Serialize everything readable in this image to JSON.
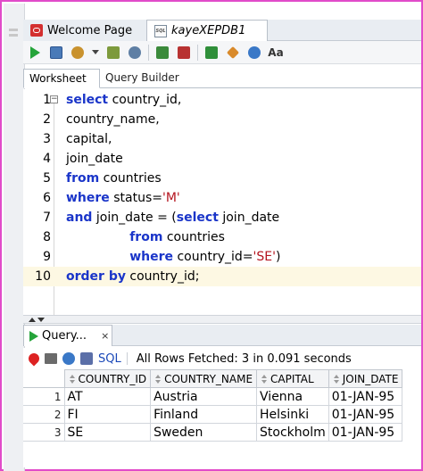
{
  "colors": {
    "frame_border": "#e14bc9",
    "keyword": "#1a35c9",
    "string_literal": "#b4141e",
    "run_icon": "#25a43a",
    "current_line_bg": "#fdf8e3"
  },
  "tabs": [
    {
      "label": "Welcome Page",
      "icon": "oracle-icon"
    },
    {
      "label": "kayeXEPDB1",
      "icon": "sql-worksheet-icon",
      "active": true
    }
  ],
  "toolbar": {
    "buttons": [
      "run-statement-icon",
      "run-script-icon",
      "commit-icon",
      "dropdown-arrow-icon",
      "explain-plan-icon",
      "autotrace-icon",
      "commit-transaction-icon",
      "rollback-icon",
      "sql-tuning-icon",
      "clear-icon",
      "sql-history-icon",
      "to-upper-lower-icon"
    ]
  },
  "worksheet_tabs": [
    {
      "label": "Worksheet",
      "active": true
    },
    {
      "label": "Query Builder",
      "active": false
    }
  ],
  "editor": {
    "current_line": 10,
    "lines": [
      {
        "n": "1",
        "tokens": [
          {
            "t": "select",
            "k": "kw"
          },
          {
            "t": " country_id,",
            "k": ""
          }
        ]
      },
      {
        "n": "2",
        "tokens": [
          {
            "t": "country_name,",
            "k": ""
          }
        ]
      },
      {
        "n": "3",
        "tokens": [
          {
            "t": "capital,",
            "k": ""
          }
        ]
      },
      {
        "n": "4",
        "tokens": [
          {
            "t": "join_date",
            "k": ""
          }
        ]
      },
      {
        "n": "5",
        "tokens": [
          {
            "t": "from",
            "k": "kw"
          },
          {
            "t": " countries",
            "k": ""
          }
        ]
      },
      {
        "n": "6",
        "tokens": [
          {
            "t": "where",
            "k": "kw"
          },
          {
            "t": " status=",
            "k": ""
          },
          {
            "t": "'M'",
            "k": "str"
          }
        ]
      },
      {
        "n": "7",
        "tokens": [
          {
            "t": "and",
            "k": "kw"
          },
          {
            "t": " join_date = (",
            "k": ""
          },
          {
            "t": "select",
            "k": "kw"
          },
          {
            "t": " join_date",
            "k": ""
          }
        ]
      },
      {
        "n": "8",
        "tokens": [
          {
            "t": "                ",
            "k": ""
          },
          {
            "t": "from",
            "k": "kw"
          },
          {
            "t": " countries",
            "k": ""
          }
        ]
      },
      {
        "n": "9",
        "tokens": [
          {
            "t": "                ",
            "k": ""
          },
          {
            "t": "where",
            "k": "kw"
          },
          {
            "t": " country_id=",
            "k": ""
          },
          {
            "t": "'SE'",
            "k": "str"
          },
          {
            "t": ")",
            "k": ""
          }
        ]
      },
      {
        "n": "10",
        "tokens": [
          {
            "t": "order by",
            "k": "kw"
          },
          {
            "t": " country_id;",
            "k": ""
          }
        ]
      }
    ]
  },
  "results": {
    "tab_label": "Query...",
    "close_glyph": "×",
    "sql_link": "SQL",
    "status": "All Rows Fetched: 3 in 0.091 seconds",
    "columns": [
      "COUNTRY_ID",
      "COUNTRY_NAME",
      "CAPITAL",
      "JOIN_DATE"
    ],
    "rows": [
      {
        "n": "1",
        "cells": [
          "AT",
          "Austria",
          "Vienna",
          "01-JAN-95"
        ]
      },
      {
        "n": "2",
        "cells": [
          "FI",
          "Finland",
          "Helsinki",
          "01-JAN-95"
        ]
      },
      {
        "n": "3",
        "cells": [
          "SE",
          "Sweden",
          "Stockholm",
          "01-JAN-95"
        ]
      }
    ]
  }
}
